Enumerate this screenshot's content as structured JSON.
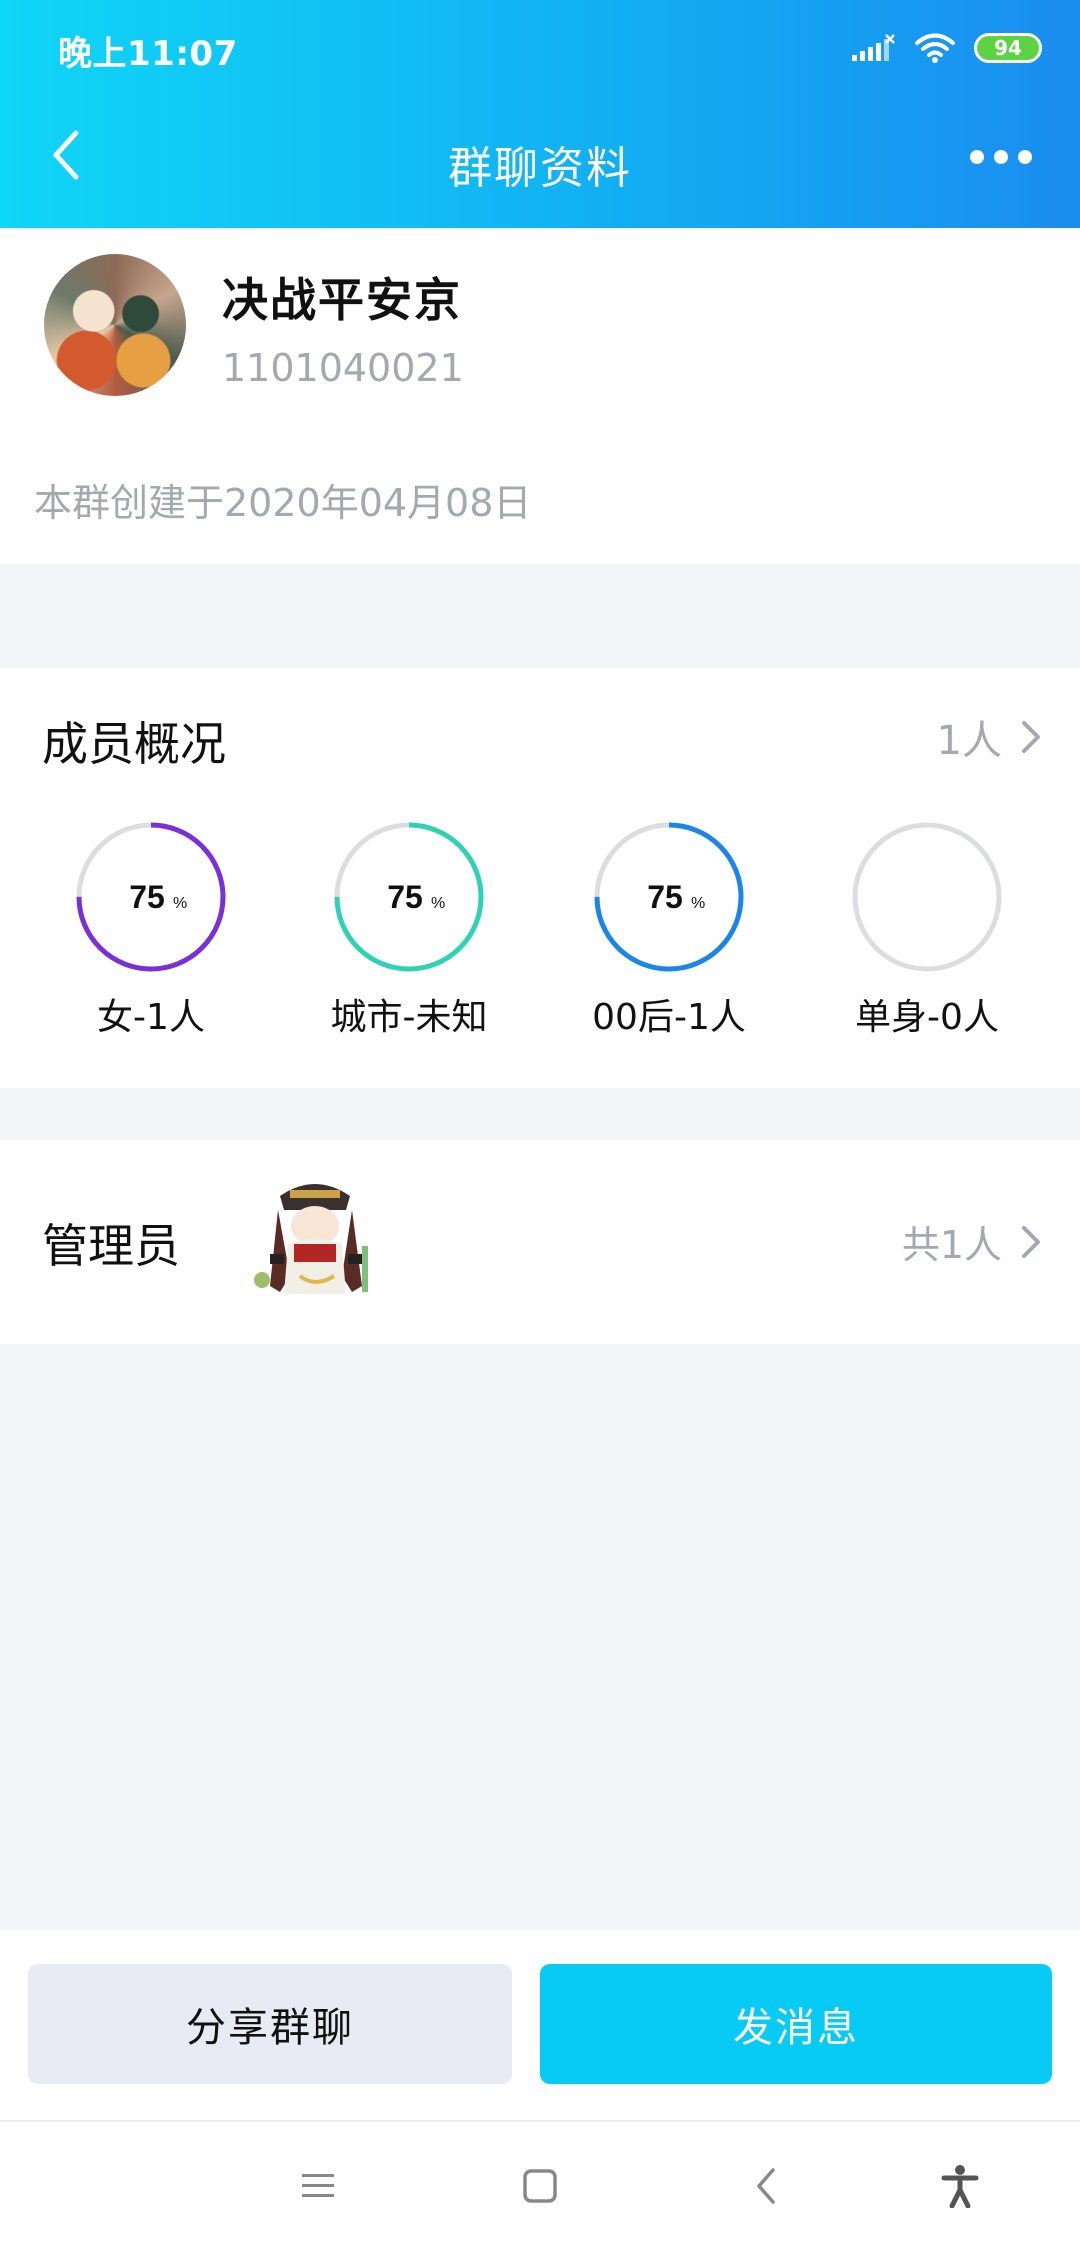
{
  "status_bar": {
    "time": "晚上11:07",
    "battery": "94",
    "icons": [
      "signal-icon",
      "wifi-icon",
      "battery-icon"
    ]
  },
  "nav": {
    "title": "群聊资料",
    "back_icon": "back-arrow-icon",
    "more_icon": "more-dots-icon"
  },
  "group": {
    "name": "决战平安京",
    "id": "1101040021",
    "created": "本群创建于2020年04月08日"
  },
  "members": {
    "title": "成员概况",
    "count": "1人",
    "stats": [
      {
        "label": "女-1人",
        "percent": "75",
        "unit": "%",
        "fill": 0.75,
        "color": "#7b2fd6"
      },
      {
        "label": "城市-未知",
        "percent": "75",
        "unit": "%",
        "fill": 0.75,
        "color": "#2ed3b5"
      },
      {
        "label": "00后-1人",
        "percent": "75",
        "unit": "%",
        "fill": 0.75,
        "color": "#1b86e8"
      },
      {
        "label": "单身-0人",
        "percent": "",
        "unit": "",
        "fill": 0,
        "color": "#dcdde0"
      }
    ]
  },
  "admin": {
    "title": "管理员",
    "count": "共1人"
  },
  "actions": {
    "share": "分享群聊",
    "send": "发消息"
  },
  "colors": {
    "header_start": "#10d6f7",
    "header_end": "#1a8df0",
    "primary_button": "#08cbf5",
    "secondary_text": "#a4a8b0"
  }
}
